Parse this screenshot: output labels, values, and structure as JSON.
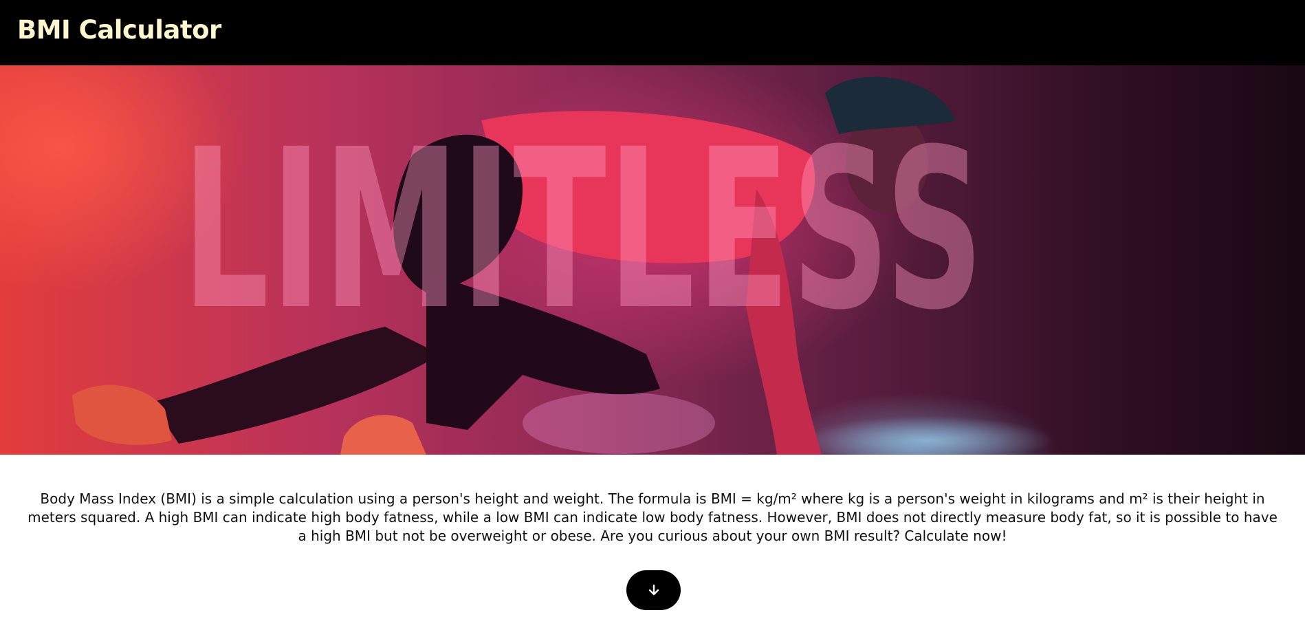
{
  "navbar": {
    "brand": "BMI Calculator"
  },
  "hero": {
    "overlay_text": "LIMITLESS",
    "image": "sprinter-in-starting-position-photo"
  },
  "intro": {
    "text": "Body Mass Index (BMI) is a simple calculation using a person's height and weight. The formula is BMI = kg/m² where kg is a person's weight in kilograms and m² is their height in meters squared. A high BMI can indicate high body fatness, while a low BMI can indicate low body fatness. However, BMI does not directly measure body fat, so it is possible to have a high BMI but not be overweight or obese. Are you curious about your own BMI result? Calculate now!"
  },
  "scroll_button": {
    "icon": "arrow-down-icon"
  },
  "colors": {
    "navbar_bg": "#000000",
    "brand_text": "#fff6cf",
    "button_bg": "#000000",
    "body_text": "#111111"
  }
}
